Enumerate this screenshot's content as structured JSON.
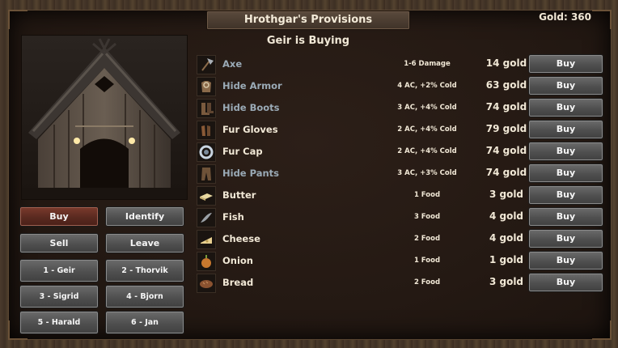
{
  "shop": {
    "title": "Hrothgar's Provisions",
    "gold_label": "Gold: 360",
    "subtitle": "Geir is Buying"
  },
  "actions": [
    {
      "label": "Buy",
      "active": true
    },
    {
      "label": "Identify",
      "active": false
    },
    {
      "label": "Sell",
      "active": false
    },
    {
      "label": "Leave",
      "active": false
    }
  ],
  "party": [
    {
      "label": "1 - Geir"
    },
    {
      "label": "2 - Thorvik"
    },
    {
      "label": "3 - Sigrid"
    },
    {
      "label": "4 - Bjorn"
    },
    {
      "label": "5 - Harald"
    },
    {
      "label": "6 - Jan"
    }
  ],
  "items": [
    {
      "name": "Axe",
      "stat": "1-6 Damage",
      "price": "14 gold",
      "buy": "Buy",
      "icon": "axe-icon",
      "name_color": "#9aaab6"
    },
    {
      "name": "Hide Armor",
      "stat": "4 AC, +2% Cold",
      "price": "63 gold",
      "buy": "Buy",
      "icon": "armor-icon",
      "name_color": "#9aaab6"
    },
    {
      "name": "Hide Boots",
      "stat": "3 AC, +4% Cold",
      "price": "74 gold",
      "buy": "Buy",
      "icon": "boots-icon",
      "name_color": "#9aaab6"
    },
    {
      "name": "Fur Gloves",
      "stat": "2 AC, +4% Cold",
      "price": "79 gold",
      "buy": "Buy",
      "icon": "gloves-icon",
      "name_color": "#f1e8d6"
    },
    {
      "name": "Fur Cap",
      "stat": "2 AC, +4% Cold",
      "price": "74 gold",
      "buy": "Buy",
      "icon": "cap-icon",
      "name_color": "#f1e8d6"
    },
    {
      "name": "Hide Pants",
      "stat": "3 AC, +3% Cold",
      "price": "74 gold",
      "buy": "Buy",
      "icon": "pants-icon",
      "name_color": "#9aaab6"
    },
    {
      "name": "Butter",
      "stat": "1 Food",
      "price": "3 gold",
      "buy": "Buy",
      "icon": "butter-icon",
      "name_color": "#f1e8d6"
    },
    {
      "name": "Fish",
      "stat": "3 Food",
      "price": "4 gold",
      "buy": "Buy",
      "icon": "fish-icon",
      "name_color": "#f1e8d6"
    },
    {
      "name": "Cheese",
      "stat": "2 Food",
      "price": "4 gold",
      "buy": "Buy",
      "icon": "cheese-icon",
      "name_color": "#f1e8d6"
    },
    {
      "name": "Onion",
      "stat": "1 Food",
      "price": "1 gold",
      "buy": "Buy",
      "icon": "onion-icon",
      "name_color": "#f1e8d6"
    },
    {
      "name": "Bread",
      "stat": "2 Food",
      "price": "3 gold",
      "buy": "Buy",
      "icon": "bread-icon",
      "name_color": "#f1e8d6"
    }
  ]
}
